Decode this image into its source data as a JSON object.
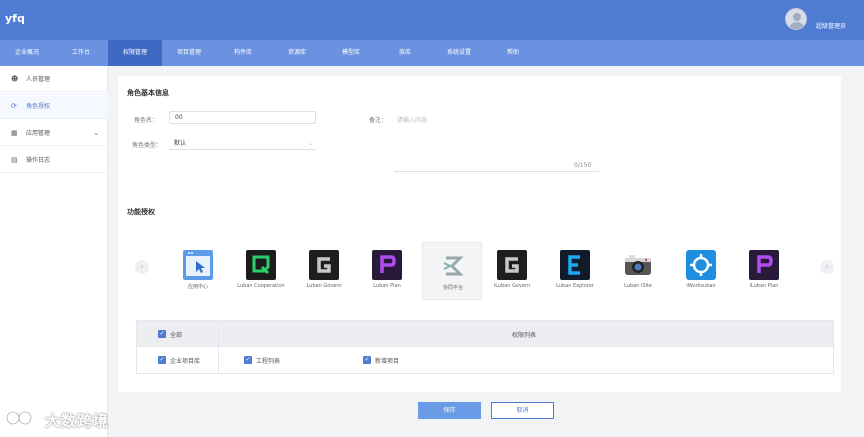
{
  "header": {
    "title": "yfq",
    "user_name": "超级管理员"
  },
  "nav": {
    "tabs": [
      {
        "label": "企业概况",
        "active": false
      },
      {
        "label": "工作台",
        "active": false
      },
      {
        "label": "权限管理",
        "active": true
      },
      {
        "label": "项目管理",
        "active": false
      },
      {
        "label": "构件库",
        "active": false
      },
      {
        "label": "资源库",
        "active": false
      },
      {
        "label": "模型库",
        "active": false
      },
      {
        "label": "族库",
        "active": false
      },
      {
        "label": "系统设置",
        "active": false
      },
      {
        "label": "帮助",
        "active": false
      }
    ]
  },
  "sidebar": {
    "items": [
      {
        "label": "人员管理",
        "icon": "user-icon",
        "active": false
      },
      {
        "label": "角色授权",
        "icon": "role-icon",
        "active": true
      },
      {
        "label": "应用管理",
        "icon": "grid-icon",
        "active": false,
        "expandable": true
      },
      {
        "label": "操作日志",
        "icon": "log-icon",
        "active": false
      }
    ]
  },
  "form": {
    "basic_title": "角色基本信息",
    "role_name_label": "角色名：",
    "role_name_value": "00",
    "remark_label": "备注：",
    "remark_placeholder": "请输入内容",
    "role_type_label": "角色类型：",
    "role_type_value": "默认",
    "counter": "0/150"
  },
  "apps": {
    "section_title": "功能授权",
    "items": [
      {
        "name": "应用中心",
        "icon": "app-center-icon",
        "selected": false
      },
      {
        "name": "Luban Cooperation",
        "icon": "cooperation-icon",
        "selected": false
      },
      {
        "name": "Luban Govern",
        "icon": "govern-icon",
        "selected": false
      },
      {
        "name": "Luban Plan",
        "icon": "plan-icon",
        "selected": false
      },
      {
        "name": "协同平台",
        "icon": "collab-icon",
        "selected": true
      },
      {
        "name": "iLuban Govern",
        "icon": "ilu-govern-icon",
        "selected": false
      },
      {
        "name": "Luban Explorer",
        "icon": "explorer-icon",
        "selected": false
      },
      {
        "name": "Luban iSite",
        "icon": "isite-icon",
        "selected": false
      },
      {
        "name": "iWorksuban",
        "icon": "iworks-icon",
        "selected": false
      },
      {
        "name": "iLuban Plan",
        "icon": "ilu-plan-icon",
        "selected": false
      }
    ]
  },
  "permissions": {
    "select_all": "全部",
    "header": "权限列表",
    "group": "企业项目库",
    "items": [
      "工程列表",
      "新增项目"
    ]
  },
  "actions": {
    "save": "保存",
    "cancel": "取消"
  },
  "watermark": {
    "text": "大数跨境"
  },
  "colors": {
    "header": "#4f7bd3",
    "nav": "#6a92e0",
    "nav_active": "#3e6ac4",
    "primary": "#6a9be6"
  }
}
